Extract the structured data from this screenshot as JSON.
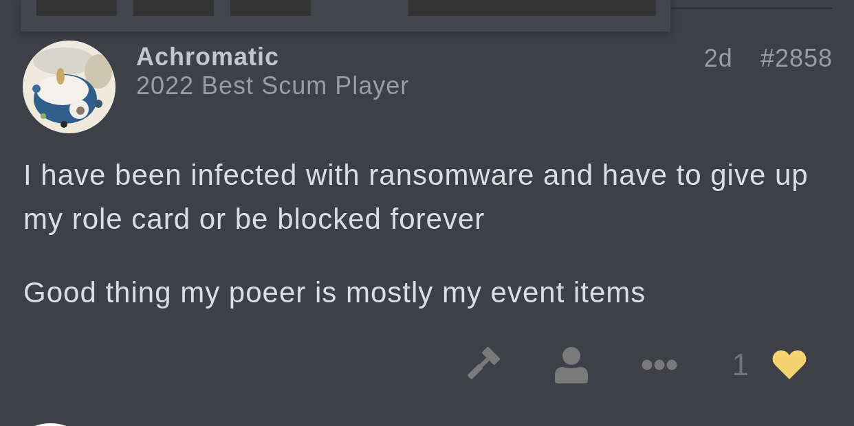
{
  "post": {
    "username": "Achromatic",
    "user_title": "2022 Best Scum Player",
    "age": "2d",
    "post_number": "#2858",
    "paragraphs": [
      "I have been infected with ransomware and have to give up my role card or be blocked forever",
      "Good thing my poeer is mostly my event items"
    ],
    "actions": [
      {
        "kind": "gavel"
      },
      {
        "kind": "user"
      },
      {
        "kind": "more"
      }
    ],
    "likes": {
      "count": "1",
      "liked": true
    }
  }
}
